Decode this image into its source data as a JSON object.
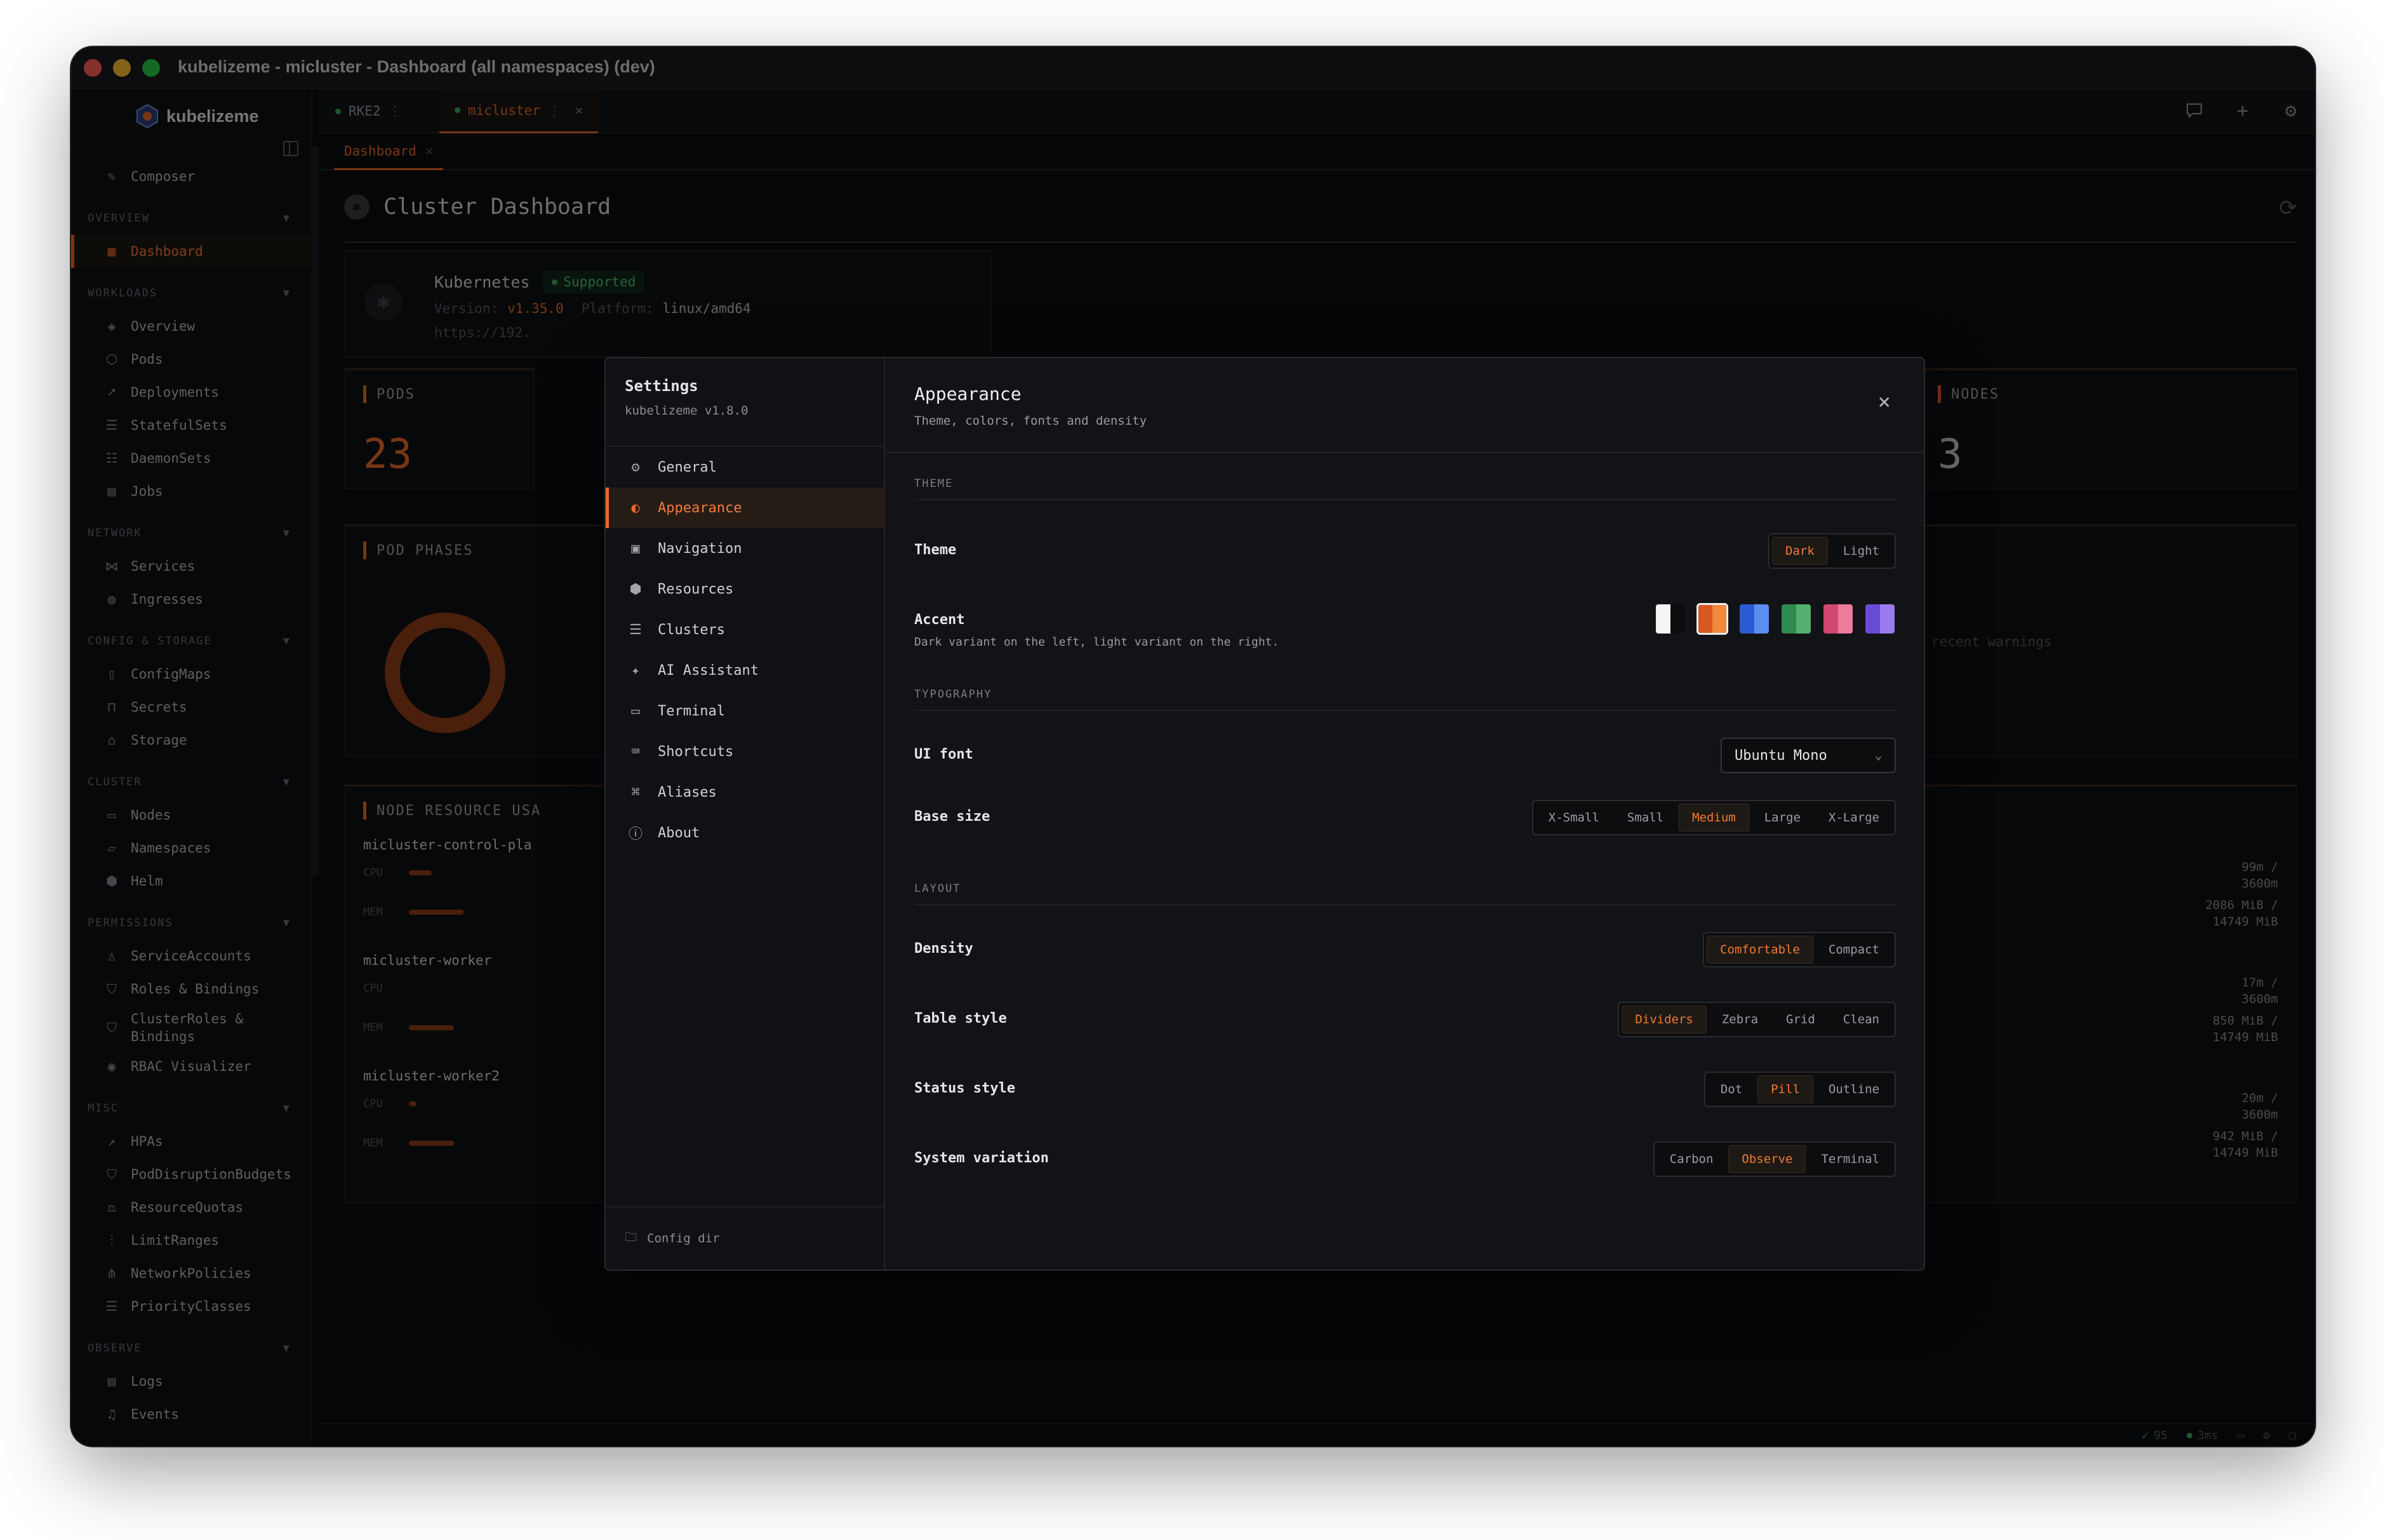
{
  "window": {
    "title": "kubelizeme - micluster - Dashboard (all namespaces) (dev)"
  },
  "colors": {
    "accent": "#e8692a",
    "background": "#0b0c0e",
    "success": "#3fa55a"
  },
  "app": {
    "name": "kubelizeme"
  },
  "tabs": [
    {
      "label": "RKE2",
      "status": "connected"
    },
    {
      "label": "micluster",
      "close": "×",
      "status": "connected"
    }
  ],
  "subtab": {
    "label": "Dashboard",
    "close": "×"
  },
  "sidebar": {
    "composer": "Composer",
    "sections": [
      {
        "title": "OVERVIEW",
        "items": [
          {
            "label": "Dashboard",
            "icon": "grid-icon"
          }
        ]
      },
      {
        "title": "WORKLOADS",
        "items": [
          {
            "label": "Overview",
            "icon": "layers-icon"
          },
          {
            "label": "Pods",
            "icon": "cube-icon"
          },
          {
            "label": "Deployments",
            "icon": "rocket-icon"
          },
          {
            "label": "StatefulSets",
            "icon": "database-icon"
          },
          {
            "label": "DaemonSets",
            "icon": "server-icon"
          },
          {
            "label": "Jobs",
            "icon": "briefcase-icon"
          }
        ]
      },
      {
        "title": "NETWORK",
        "items": [
          {
            "label": "Services",
            "icon": "share-icon"
          },
          {
            "label": "Ingresses",
            "icon": "globe-icon"
          }
        ]
      },
      {
        "title": "CONFIG & STORAGE",
        "items": [
          {
            "label": "ConfigMaps",
            "icon": "file-icon"
          },
          {
            "label": "Secrets",
            "icon": "lock-icon"
          },
          {
            "label": "Storage",
            "icon": "drive-icon"
          }
        ]
      },
      {
        "title": "CLUSTER",
        "items": [
          {
            "label": "Nodes",
            "icon": "monitor-icon"
          },
          {
            "label": "Namespaces",
            "icon": "folder-icon"
          },
          {
            "label": "Helm",
            "icon": "package-icon"
          }
        ]
      },
      {
        "title": "PERMISSIONS",
        "items": [
          {
            "label": "ServiceAccounts",
            "icon": "user-icon"
          },
          {
            "label": "Roles & Bindings",
            "icon": "shield-icon"
          },
          {
            "label": "ClusterRoles & Bindings",
            "icon": "shield-check-icon"
          },
          {
            "label": "RBAC Visualizer",
            "icon": "eye-icon"
          }
        ]
      },
      {
        "title": "MISC",
        "items": [
          {
            "label": "HPAs",
            "icon": "trending-up-icon"
          },
          {
            "label": "PodDisruptionBudgets",
            "icon": "shield-alert-icon"
          },
          {
            "label": "ResourceQuotas",
            "icon": "scale-icon"
          },
          {
            "label": "LimitRanges",
            "icon": "sliders-icon"
          },
          {
            "label": "NetworkPolicies",
            "icon": "network-icon"
          },
          {
            "label": "PriorityClasses",
            "icon": "list-ordered-icon"
          }
        ]
      },
      {
        "title": "OBSERVE",
        "items": [
          {
            "label": "Logs",
            "icon": "logs-icon"
          },
          {
            "label": "Events",
            "icon": "bell-icon"
          }
        ]
      }
    ]
  },
  "dashboard": {
    "title": "Cluster Dashboard",
    "kubernetes": {
      "label": "Kubernetes",
      "badge": "Supported",
      "version_label": "Version:",
      "version": "v1.35.0",
      "platform_label": "Platform:",
      "platform": "linux/amd64",
      "url": "https://192."
    },
    "pods": {
      "label": "PODS",
      "value": "23"
    },
    "nodes": {
      "label": "NODES",
      "value": "3"
    },
    "pod_phases": {
      "label": "POD PHASES"
    },
    "warnings": {
      "empty": "No recent warnings"
    },
    "node_resource": {
      "label": "NODE RESOURCE USA",
      "nodes": [
        {
          "name": "micluster-control-pla",
          "cpu_label": "CPU",
          "mem_label": "MEM",
          "cpu": "99m /",
          "cpu_total": "3600m",
          "mem": "2086 MiB /",
          "mem_total": "14749 MiB",
          "cpu_frac": 0.4,
          "mem_frac": 0.95
        },
        {
          "name": "micluster-worker",
          "cpu_label": "CPU",
          "mem_label": "MEM",
          "cpu": "17m /",
          "cpu_total": "3600m",
          "mem": "850 MiB /",
          "mem_total": "14749 MiB",
          "cpu_frac": 0.0,
          "mem_frac": 0.79
        },
        {
          "name": "micluster-worker2",
          "cpu_label": "CPU",
          "mem_label": "MEM",
          "cpu": "20m /",
          "cpu_total": "3600m",
          "mem": "942 MiB /",
          "mem_total": "14749 MiB",
          "cpu_frac": 0.13,
          "mem_frac": 0.79
        }
      ]
    }
  },
  "statusbar": {
    "checks": "95",
    "latency": "3ms"
  },
  "settings": {
    "title": "Settings",
    "version": "kubelizeme v1.8.0",
    "nav": [
      {
        "label": "General",
        "icon": "gear-icon",
        "glyph": "⚙"
      },
      {
        "label": "Appearance",
        "icon": "palette-icon",
        "glyph": "◐"
      },
      {
        "label": "Navigation",
        "icon": "sidebar-icon",
        "glyph": "▣"
      },
      {
        "label": "Resources",
        "icon": "boxes-icon",
        "glyph": "⬢"
      },
      {
        "label": "Clusters",
        "icon": "server-icon",
        "glyph": "☰"
      },
      {
        "label": "AI Assistant",
        "icon": "sparkles-icon",
        "glyph": "✦"
      },
      {
        "label": "Terminal",
        "icon": "terminal-icon",
        "glyph": "▭"
      },
      {
        "label": "Shortcuts",
        "icon": "keyboard-icon",
        "glyph": "⌨"
      },
      {
        "label": "Aliases",
        "icon": "command-icon",
        "glyph": "⌘"
      },
      {
        "label": "About",
        "icon": "info-icon",
        "glyph": "ⓘ"
      }
    ],
    "config_dir": "Config dir",
    "appearance": {
      "title": "Appearance",
      "subtitle": "Theme, colors, fonts and density",
      "sections": {
        "theme": "THEME",
        "typography": "TYPOGRAPHY",
        "layout": "LAYOUT"
      },
      "theme": {
        "label": "Theme",
        "options": [
          "Dark",
          "Light"
        ],
        "selected": "Dark"
      },
      "accent": {
        "label": "Accent",
        "description": "Dark variant on the left, light variant on the right.",
        "swatches": [
          [
            "#f5f5f5",
            "#0d0d0f"
          ],
          [
            "#d9581f",
            "#f08a3c"
          ],
          [
            "#2a5bd7",
            "#5b8ef0"
          ],
          [
            "#2e8a4e",
            "#54b06e"
          ],
          [
            "#d0486f",
            "#ef7a9a"
          ],
          [
            "#6a4ad8",
            "#9b7af0"
          ]
        ],
        "selected": 1
      },
      "ui_font": {
        "label": "UI font",
        "value": "Ubuntu Mono"
      },
      "base_size": {
        "label": "Base size",
        "options": [
          "X-Small",
          "Small",
          "Medium",
          "Large",
          "X-Large"
        ],
        "selected": "Medium"
      },
      "density": {
        "label": "Density",
        "options": [
          "Comfortable",
          "Compact"
        ],
        "selected": "Comfortable"
      },
      "table_style": {
        "label": "Table style",
        "options": [
          "Dividers",
          "Zebra",
          "Grid",
          "Clean"
        ],
        "selected": "Dividers"
      },
      "status_style": {
        "label": "Status style",
        "options": [
          "Dot",
          "Pill",
          "Outline"
        ],
        "selected": "Pill"
      },
      "system_variation": {
        "label": "System variation",
        "options": [
          "Carbon",
          "Observe",
          "Terminal"
        ],
        "selected": "Observe"
      }
    }
  }
}
